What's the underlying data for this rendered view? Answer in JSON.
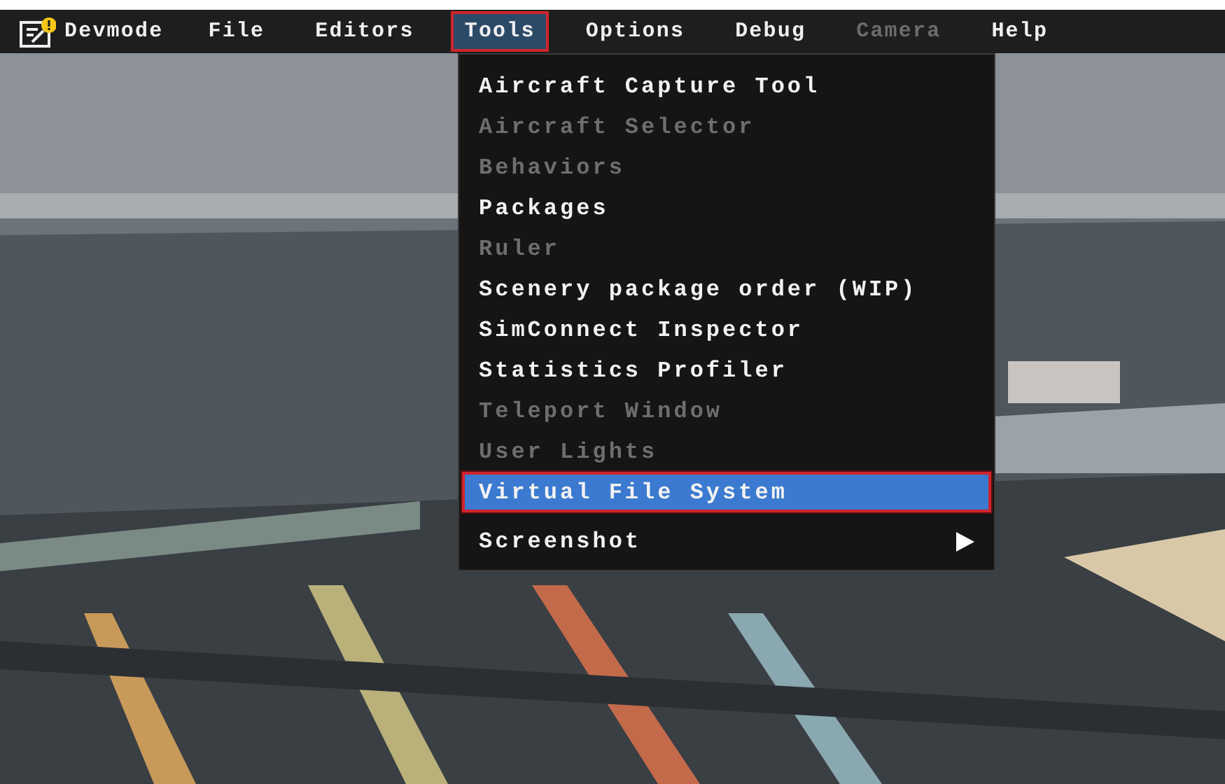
{
  "menubar": {
    "items": [
      {
        "label": "Devmode",
        "kind": "app",
        "selected": false,
        "disabled": false
      },
      {
        "label": "File",
        "kind": "menu",
        "selected": false,
        "disabled": false
      },
      {
        "label": "Editors",
        "kind": "menu",
        "selected": false,
        "disabled": false
      },
      {
        "label": "Tools",
        "kind": "menu",
        "selected": true,
        "disabled": false
      },
      {
        "label": "Options",
        "kind": "menu",
        "selected": false,
        "disabled": false
      },
      {
        "label": "Debug",
        "kind": "menu",
        "selected": false,
        "disabled": false
      },
      {
        "label": "Camera",
        "kind": "menu",
        "selected": false,
        "disabled": true
      },
      {
        "label": "Help",
        "kind": "menu",
        "selected": false,
        "disabled": false
      }
    ]
  },
  "tools_menu": {
    "items": [
      {
        "label": "Aircraft Capture Tool",
        "kind": "item",
        "selected": false,
        "disabled": false
      },
      {
        "label": "Aircraft Selector",
        "kind": "item",
        "selected": false,
        "disabled": true
      },
      {
        "label": "Behaviors",
        "kind": "item",
        "selected": false,
        "disabled": true
      },
      {
        "label": "Packages",
        "kind": "item",
        "selected": false,
        "disabled": false
      },
      {
        "label": "Ruler",
        "kind": "item",
        "selected": false,
        "disabled": true
      },
      {
        "label": "Scenery package order (WIP)",
        "kind": "item",
        "selected": false,
        "disabled": false
      },
      {
        "label": "SimConnect Inspector",
        "kind": "item",
        "selected": false,
        "disabled": false
      },
      {
        "label": "Statistics Profiler",
        "kind": "item",
        "selected": false,
        "disabled": false
      },
      {
        "label": "Teleport Window",
        "kind": "item",
        "selected": false,
        "disabled": true
      },
      {
        "label": "User Lights",
        "kind": "item",
        "selected": false,
        "disabled": true
      },
      {
        "label": "Virtual File System",
        "kind": "item",
        "selected": true,
        "disabled": false
      },
      {
        "label": "Screenshot",
        "kind": "submenu",
        "selected": false,
        "disabled": false
      }
    ]
  }
}
